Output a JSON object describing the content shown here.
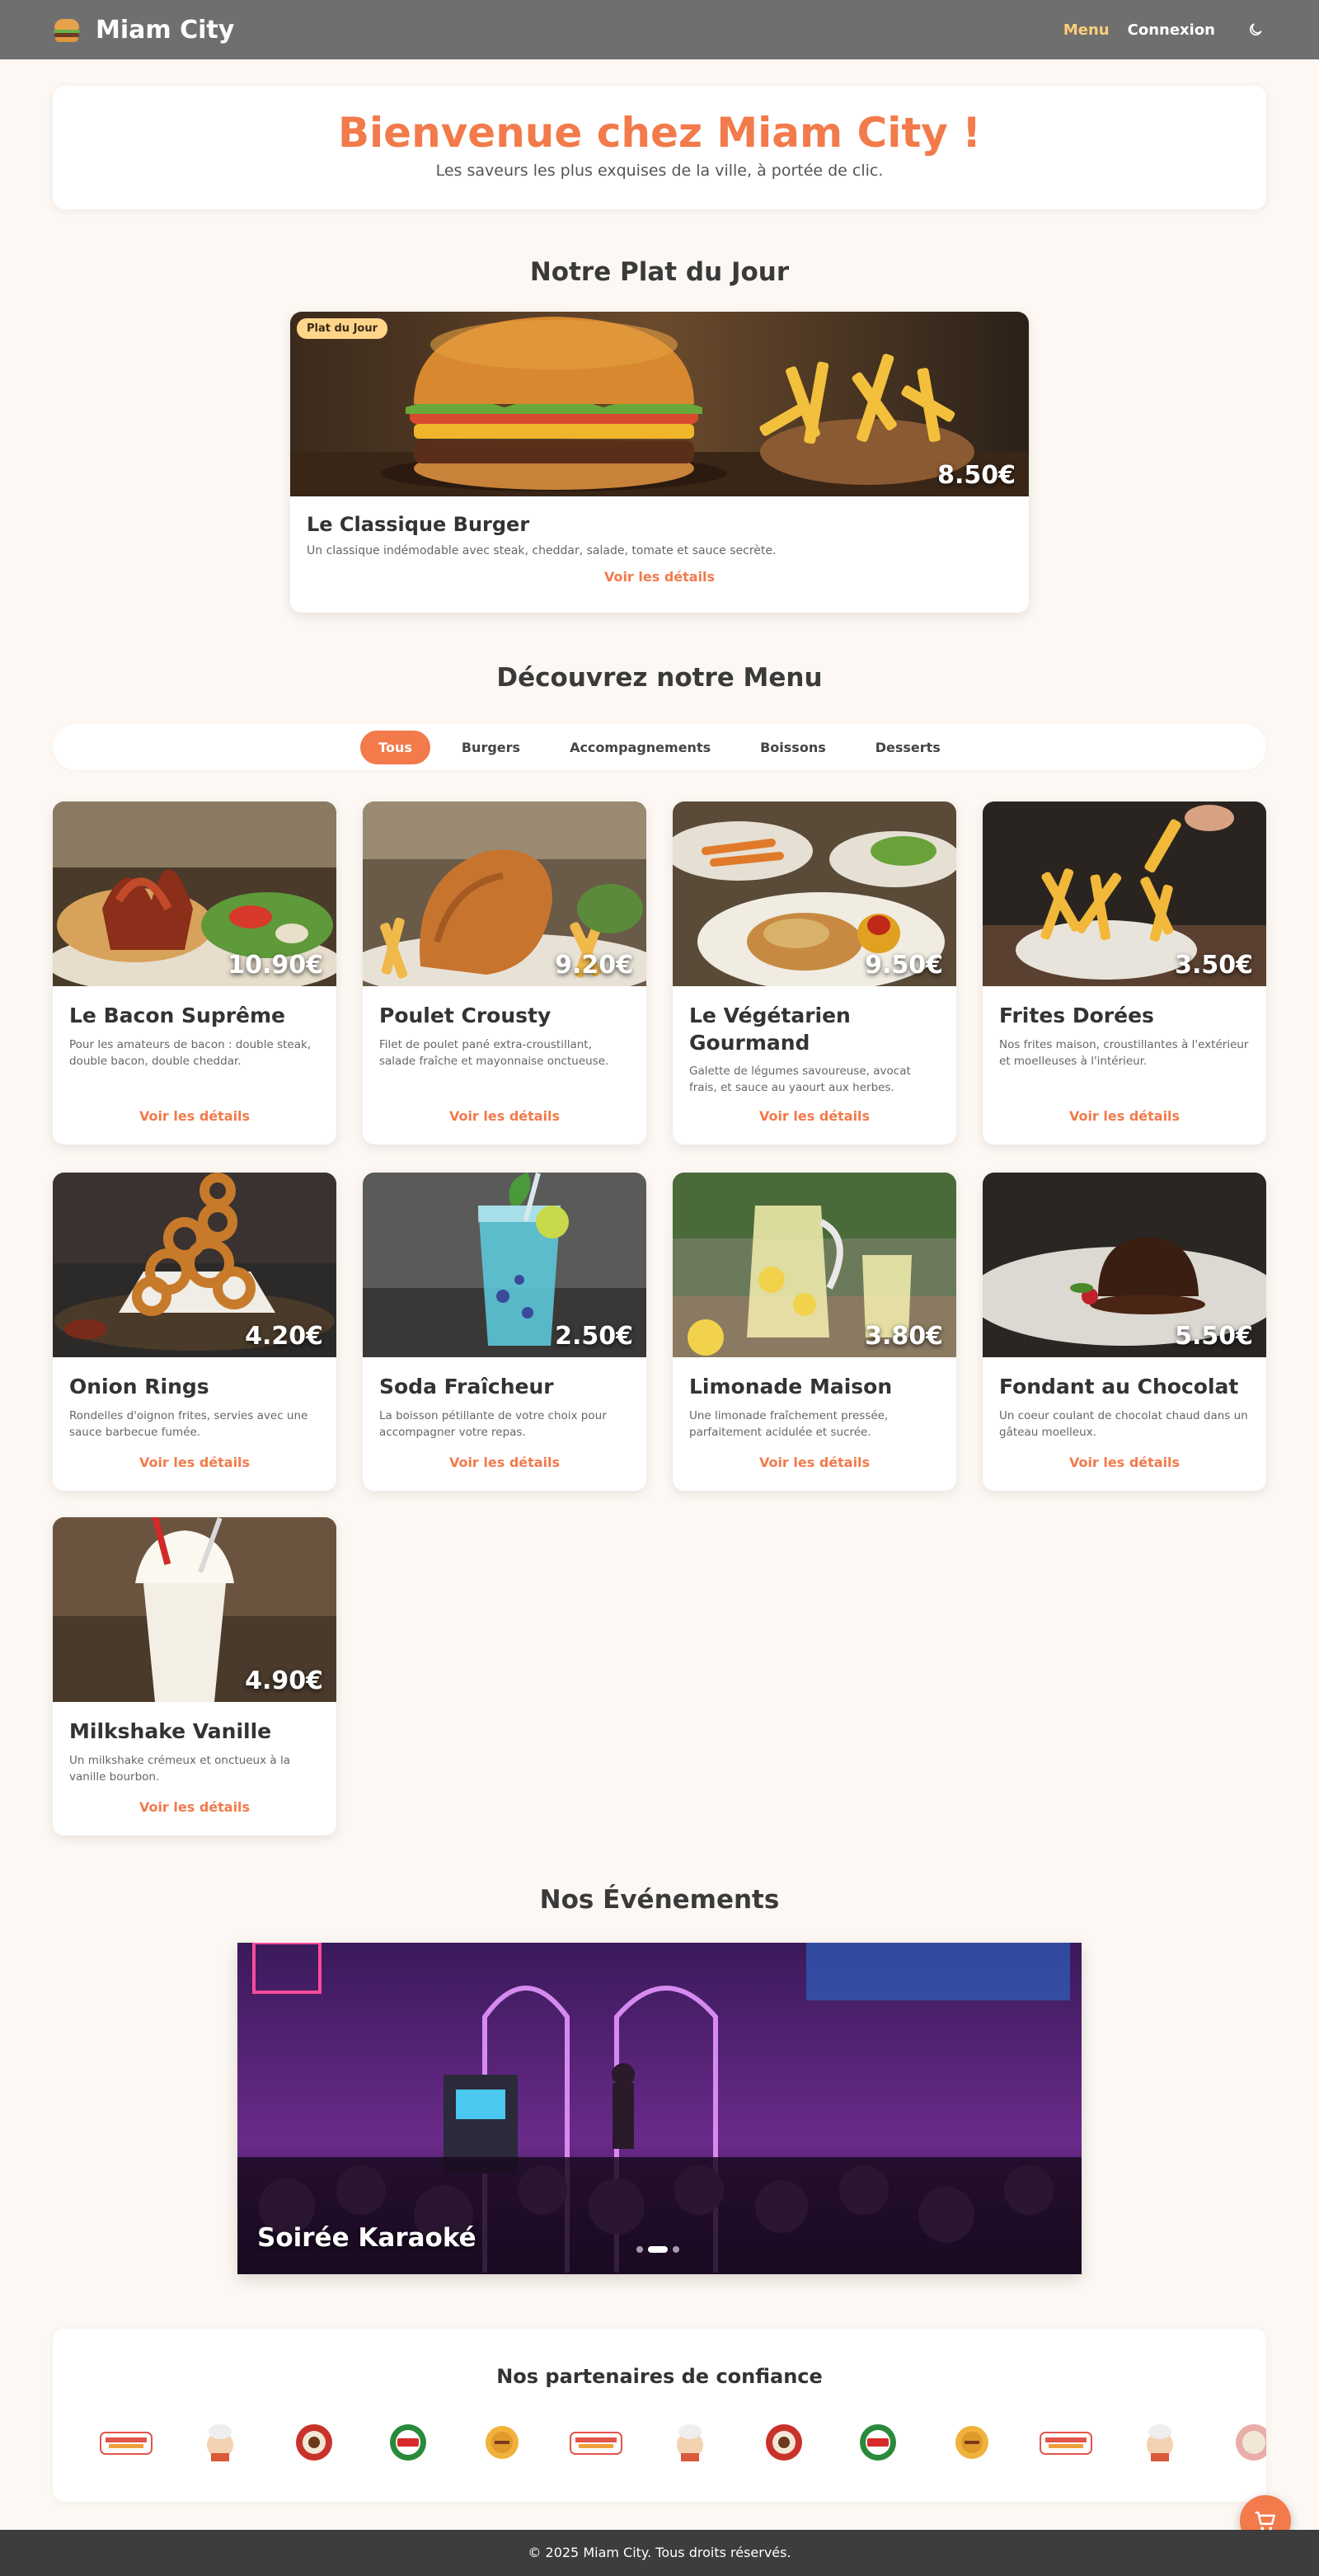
{
  "nav": {
    "brand": "Miam City",
    "links": [
      {
        "label": "Menu"
      },
      {
        "label": "Connexion"
      }
    ]
  },
  "hero": {
    "title": "Bienvenue chez Miam City !",
    "subtitle": "Les saveurs les plus exquises de la ville, à portée de clic."
  },
  "dish_of_day": {
    "section_title": "Notre Plat du Jour",
    "badge": "Plat du Jour",
    "price": "8.50€",
    "name": "Le Classique Burger",
    "description": "Un classique indémodable avec steak, cheddar, salade, tomate et sauce secrète.",
    "link": "Voir les détails"
  },
  "menu": {
    "section_title": "Découvrez notre Menu",
    "filters": [
      "Tous",
      "Burgers",
      "Accompagnements",
      "Boissons",
      "Desserts"
    ],
    "active_filter": "Tous",
    "items": [
      {
        "name": "Le Bacon Suprême",
        "price": "10.90€",
        "description": "Pour les amateurs de bacon : double steak, double bacon, double cheddar.",
        "link": "Voir les détails"
      },
      {
        "name": "Poulet Crousty",
        "price": "9.20€",
        "description": "Filet de poulet pané extra-croustillant, salade fraîche et mayonnaise onctueuse.",
        "link": "Voir les détails"
      },
      {
        "name": "Le Végétarien Gourmand",
        "price": "9.50€",
        "description": "Galette de légumes savoureuse, avocat frais, et sauce au yaourt aux herbes.",
        "link": "Voir les détails"
      },
      {
        "name": "Frites Dorées",
        "price": "3.50€",
        "description": "Nos frites maison, croustillantes à l'extérieur et moelleuses à l'intérieur.",
        "link": "Voir les détails"
      },
      {
        "name": "Onion Rings",
        "price": "4.20€",
        "description": "Rondelles d'oignon frites, servies avec une sauce barbecue fumée.",
        "link": "Voir les détails"
      },
      {
        "name": "Soda Fraîcheur",
        "price": "2.50€",
        "description": "La boisson pétillante de votre choix pour accompagner votre repas.",
        "link": "Voir les détails"
      },
      {
        "name": "Limonade Maison",
        "price": "3.80€",
        "description": "Une limonade fraîchement pressée, parfaitement acidulée et sucrée.",
        "link": "Voir les détails"
      },
      {
        "name": "Fondant au Chocolat",
        "price": "5.50€",
        "description": "Un coeur coulant de chocolat chaud dans un gâteau moelleux.",
        "link": "Voir les détails"
      },
      {
        "name": "Milkshake Vanille",
        "price": "4.90€",
        "description": "Un milkshake crémeux et onctueux à la vanille bourbon.",
        "link": "Voir les détails"
      }
    ]
  },
  "events": {
    "section_title": "Nos Événements",
    "slide_title": "Soirée Karaoké"
  },
  "partners": {
    "title": "Nos partenaires de confiance"
  },
  "footer": {
    "text": "© 2025 Miam City. Tous droits réservés."
  },
  "colors": {
    "accent": "#f27a4b",
    "nav_active": "#ffcf7a",
    "navbar": "#6f6f6f",
    "background": "#fdf8f3",
    "footer": "#3d3d3d"
  }
}
